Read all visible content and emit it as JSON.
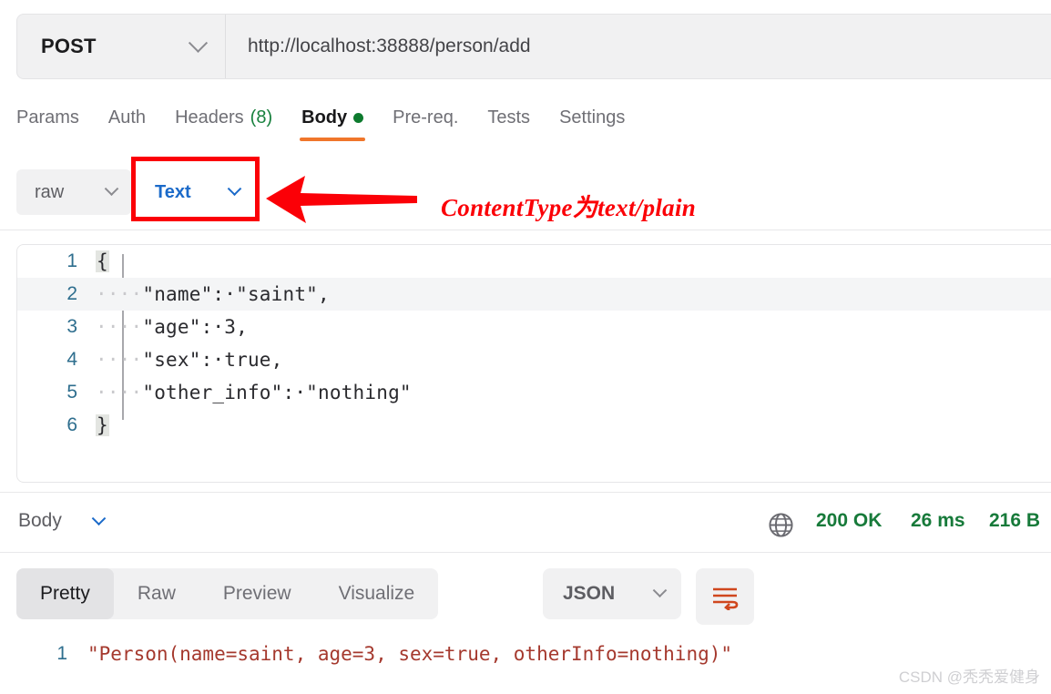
{
  "request": {
    "method": "POST",
    "url": "http://localhost:38888/person/add",
    "tabs": [
      {
        "label": "Params",
        "active": false
      },
      {
        "label": "Auth",
        "active": false
      },
      {
        "label": "Headers",
        "count": "(8)",
        "active": false
      },
      {
        "label": "Body",
        "active": true,
        "dot": true
      },
      {
        "label": "Pre-req.",
        "active": false
      },
      {
        "label": "Tests",
        "active": false
      },
      {
        "label": "Settings",
        "active": false
      }
    ],
    "body_mode": "raw",
    "body_format": "Text",
    "editor_lines": [
      {
        "num": "1",
        "indent": "",
        "text": "{",
        "brace": true,
        "highlight": false
      },
      {
        "num": "2",
        "indent": "····",
        "text": "\"name\":·\"saint\",",
        "brace": false,
        "highlight": true
      },
      {
        "num": "3",
        "indent": "····",
        "text": "\"age\":·3,",
        "brace": false,
        "highlight": false
      },
      {
        "num": "4",
        "indent": "····",
        "text": "\"sex\":·true,",
        "brace": false,
        "highlight": false
      },
      {
        "num": "5",
        "indent": "····",
        "text": "\"other_info\":·\"nothing\"",
        "brace": false,
        "highlight": false
      },
      {
        "num": "6",
        "indent": "",
        "text": "}",
        "brace": true,
        "highlight": false
      }
    ]
  },
  "annotation": {
    "text": "ContentType为text/plain",
    "color": "#fb0007"
  },
  "response": {
    "section_label": "Body",
    "status_code": "200 OK",
    "time": "26 ms",
    "size": "216 B",
    "status_color": "#177a3a",
    "view_tabs": [
      {
        "label": "Pretty",
        "active": true
      },
      {
        "label": "Raw",
        "active": false
      },
      {
        "label": "Preview",
        "active": false
      },
      {
        "label": "Visualize",
        "active": false
      }
    ],
    "format": "JSON",
    "lines": [
      {
        "num": "1",
        "text": "\"Person(name=saint, age=3, sex=true, otherInfo=nothing)\""
      }
    ]
  },
  "watermark": "CSDN @秃秃爱健身"
}
